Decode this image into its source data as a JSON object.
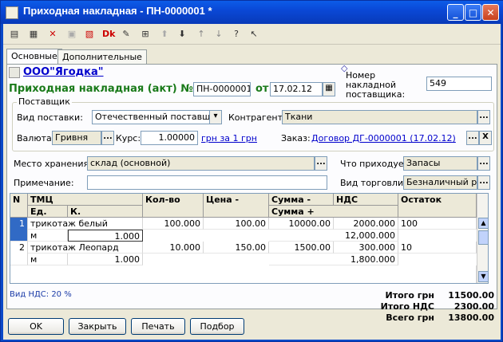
{
  "window": {
    "title": "Приходная накладная - ПН-0000001 *"
  },
  "tabs": [
    "Основные",
    "Дополнительные"
  ],
  "header": {
    "org": "ООО\"Ягодка\"",
    "doc_title": "Приходная накладная (акт) №",
    "doc_number": "ПН-0000001",
    "from_label": "от",
    "doc_date": "17.02.12",
    "invoice_num_label": "Номер накладной поставщика:",
    "invoice_num": "549"
  },
  "supplier": {
    "group_label": "Поставщик",
    "kind_label": "Вид поставки:",
    "kind": "Отечественный поставщик",
    "contractor_label": "Контрагент:",
    "contractor": "Ткани",
    "currency_label": "Валюта:",
    "currency": "Гривня",
    "rate_label": "Курс:",
    "rate": "1.00000",
    "rate_unit": "грн за 1 грн",
    "order_label": "Заказ:",
    "order": "Договор ДГ-0000001 (17.02.12)"
  },
  "storage": {
    "place_label": "Место хранения:",
    "place": "склад (основной)",
    "what_label": "Что приходуем:",
    "what": "Запасы",
    "note_label": "Примечание:",
    "note": "",
    "trade_label": "Вид торговли:",
    "trade": "Безналичный рас"
  },
  "grid": {
    "headers": {
      "n": "N",
      "tmc": "ТМЦ",
      "unit": "Ед.",
      "k": "К.",
      "qty": "Кол-во",
      "price": "Цена -",
      "sum": "Сумма -",
      "vat": "НДС",
      "sum_plus": "Сумма +",
      "rest": "Остаток"
    },
    "rows": [
      {
        "n": "1",
        "name": "трикотаж белый",
        "unit": "м",
        "k": "1.000",
        "qty": "100.000",
        "price": "100.00",
        "sum": "10000.00",
        "vat": "2000.000",
        "sum_plus": "12,000.000",
        "rest": "100"
      },
      {
        "n": "2",
        "name": "трикотаж Леопард",
        "unit": "м",
        "k": "1.000",
        "qty": "10.000",
        "price": "150.00",
        "sum": "1500.00",
        "vat": "300.000",
        "sum_plus": "1,800.000",
        "rest": "10"
      }
    ]
  },
  "vat_kind": "Вид НДС: 20 %",
  "totals": [
    {
      "label": "Итого грн",
      "value": "11500.00"
    },
    {
      "label": "Итого НДС",
      "value": "2300.00"
    },
    {
      "label": "Всего грн",
      "value": "13800.00"
    }
  ],
  "buttons": {
    "ok": "OK",
    "close": "Закрыть",
    "print": "Печать",
    "select": "Подбор"
  },
  "colors": {
    "titlebar": "#0a48d6",
    "green_title": "#1a7a1a",
    "link": "#0000cc"
  }
}
